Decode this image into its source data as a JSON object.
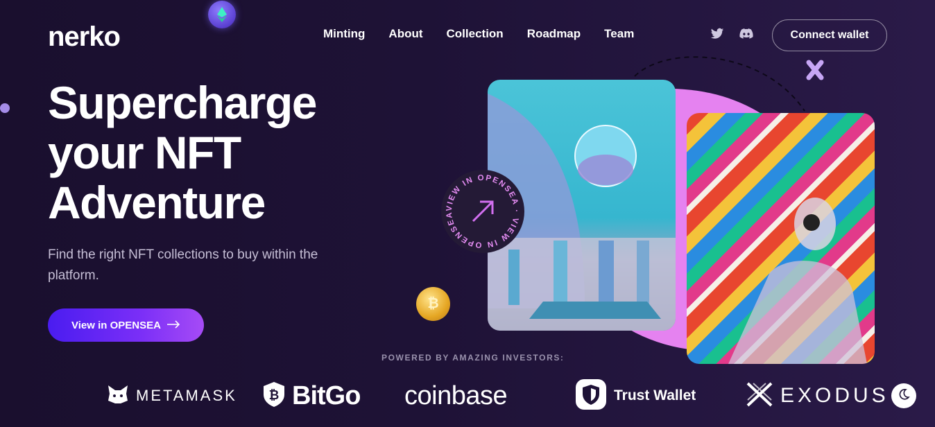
{
  "brand": {
    "logo": "nerko"
  },
  "nav": {
    "items": [
      {
        "label": "Minting"
      },
      {
        "label": "About"
      },
      {
        "label": "Collection"
      },
      {
        "label": "Roadmap"
      },
      {
        "label": "Team"
      }
    ],
    "social": [
      {
        "icon": "twitter-icon"
      },
      {
        "icon": "discord-icon"
      }
    ],
    "connect_label": "Connect wallet"
  },
  "hero": {
    "title_lines": [
      "Supercharge",
      "your NFT",
      "Adventure"
    ],
    "subtitle": "Find the right NFT collections to buy within the platform.",
    "cta_label": "View in OPENSEA",
    "cta_icon": "arrow-right-icon",
    "badge_text": "VIEW IN OPENSEA · VIEW IN OPENSEA ·"
  },
  "investors": {
    "heading": "POWERED BY AMAZING INVESTORS:",
    "items": [
      {
        "name": "METAMASK",
        "icon": "fox-icon"
      },
      {
        "name": "BitGo",
        "icon": "bitcoin-shield-icon"
      },
      {
        "name": "coinbase",
        "icon": ""
      },
      {
        "name": "Trust Wallet",
        "icon": "shield-icon"
      },
      {
        "name": "EXODUS",
        "icon": "exodus-x-icon"
      }
    ]
  },
  "colors": {
    "background": "#1e1236",
    "accent": "#7b2ff7",
    "blob": "#e582f0",
    "coin": "#e5a623"
  }
}
